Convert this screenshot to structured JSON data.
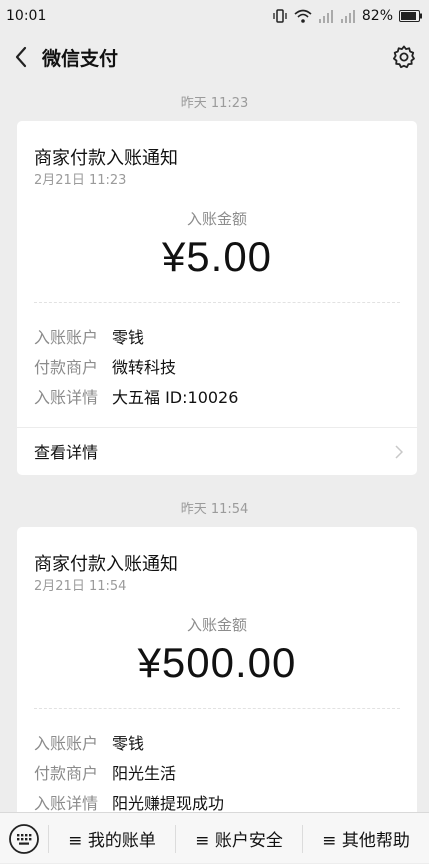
{
  "status_bar": {
    "time": "10:01",
    "battery_text": "82%",
    "icons": [
      "vibrate-icon",
      "wifi-icon",
      "signal-icon",
      "signal-icon",
      "battery-icon"
    ]
  },
  "nav": {
    "title": "微信支付",
    "back_icon": "chevron-left-icon",
    "settings_icon": "gear-icon"
  },
  "messages": [
    {
      "timestamp": "昨天 11:23",
      "title": "商家付款入账通知",
      "date": "2月21日  11:23",
      "amount_label": "入账金额",
      "amount": "¥5.00",
      "rows": [
        {
          "label": "入账账户",
          "value": "零钱"
        },
        {
          "label": "付款商户",
          "value": "微转科技"
        },
        {
          "label": "入账详情",
          "value": "大五福 ID:10026"
        }
      ],
      "details_link": "查看详情"
    },
    {
      "timestamp": "昨天 11:54",
      "title": "商家付款入账通知",
      "date": "2月21日  11:54",
      "amount_label": "入账金额",
      "amount": "¥500.00",
      "rows": [
        {
          "label": "入账账户",
          "value": "零钱"
        },
        {
          "label": "付款商户",
          "value": "阳光生活"
        },
        {
          "label": "入账详情",
          "value": "阳光赚提现成功"
        }
      ]
    }
  ],
  "bottom_menu": {
    "items": [
      "≡ 我的账单",
      "≡ 账户安全",
      "≡ 其他帮助"
    ],
    "keyboard_icon": "keyboard-icon"
  },
  "colors": {
    "background": "#ededed",
    "card": "#ffffff",
    "muted_text": "#8c8c8c",
    "primary_text": "#111111"
  }
}
